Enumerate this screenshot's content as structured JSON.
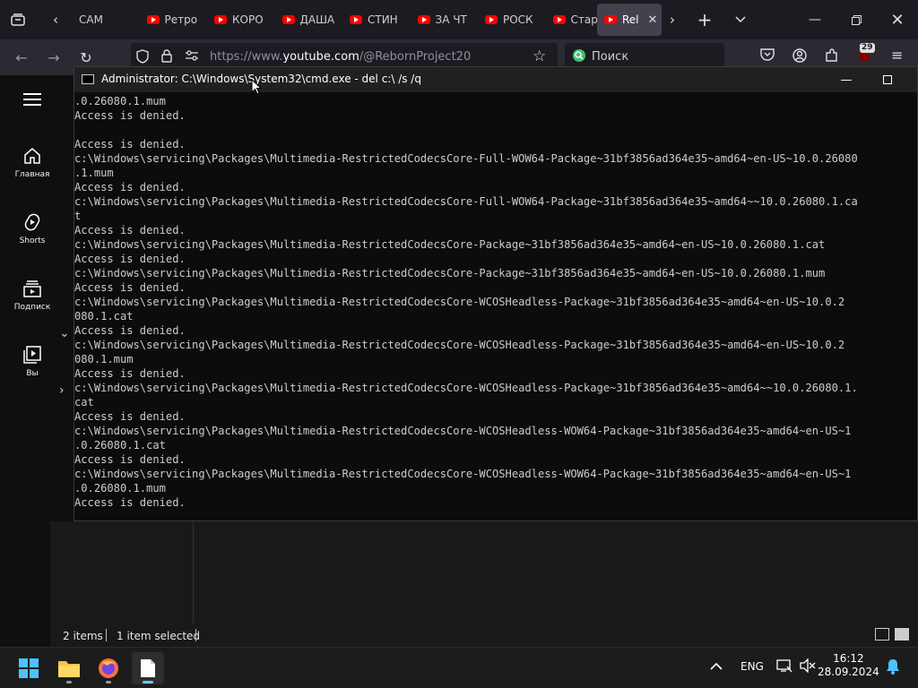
{
  "browser": {
    "tabs": [
      {
        "title": "САМ"
      },
      {
        "title": "Ретро"
      },
      {
        "title": "КОРО"
      },
      {
        "title": "ДАША"
      },
      {
        "title": "СТИН"
      },
      {
        "title": "ЗА ЧТ"
      },
      {
        "title": "РОСК"
      },
      {
        "title": "Старт"
      },
      {
        "title": "Rel",
        "active": true
      }
    ],
    "url_prefix": "https://www.",
    "url_host": "youtube.com",
    "url_path": "/@RebornProject20",
    "search_placeholder": "Поиск",
    "extension_badge": "29",
    "accent_color": "#ff0000"
  },
  "youtube": {
    "sidebar": [
      {
        "label": "Главная",
        "icon": "home-icon"
      },
      {
        "label": "Shorts",
        "icon": "shorts-icon"
      },
      {
        "label": "Подписк",
        "icon": "subscriptions-icon"
      },
      {
        "label": "Вы",
        "icon": "you-icon"
      }
    ]
  },
  "cmd": {
    "title": "Administrator: C:\\Windows\\System32\\cmd.exe - del  c:\\ /s /q",
    "lines": [
      ".0.26080.1.mum",
      "Access is denied.",
      "",
      "Access is denied.",
      "c:\\Windows\\servicing\\Packages\\Multimedia-RestrictedCodecsCore-Full-WOW64-Package~31bf3856ad364e35~amd64~en-US~10.0.26080",
      ".1.mum",
      "Access is denied.",
      "c:\\Windows\\servicing\\Packages\\Multimedia-RestrictedCodecsCore-Full-WOW64-Package~31bf3856ad364e35~amd64~~10.0.26080.1.ca",
      "t",
      "Access is denied.",
      "c:\\Windows\\servicing\\Packages\\Multimedia-RestrictedCodecsCore-Package~31bf3856ad364e35~amd64~en-US~10.0.26080.1.cat",
      "Access is denied.",
      "c:\\Windows\\servicing\\Packages\\Multimedia-RestrictedCodecsCore-Package~31bf3856ad364e35~amd64~en-US~10.0.26080.1.mum",
      "Access is denied.",
      "c:\\Windows\\servicing\\Packages\\Multimedia-RestrictedCodecsCore-WCOSHeadless-Package~31bf3856ad364e35~amd64~en-US~10.0.2",
      "080.1.cat",
      "Access is denied.",
      "c:\\Windows\\servicing\\Packages\\Multimedia-RestrictedCodecsCore-WCOSHeadless-Package~31bf3856ad364e35~amd64~en-US~10.0.2",
      "080.1.mum",
      "Access is denied.",
      "c:\\Windows\\servicing\\Packages\\Multimedia-RestrictedCodecsCore-WCOSHeadless-Package~31bf3856ad364e35~amd64~~10.0.26080.1.",
      "cat",
      "Access is denied.",
      "c:\\Windows\\servicing\\Packages\\Multimedia-RestrictedCodecsCore-WCOSHeadless-WOW64-Package~31bf3856ad364e35~amd64~en-US~1",
      ".0.26080.1.cat",
      "Access is denied.",
      "c:\\Windows\\servicing\\Packages\\Multimedia-RestrictedCodecsCore-WCOSHeadless-WOW64-Package~31bf3856ad364e35~amd64~en-US~1",
      ".0.26080.1.mum",
      "Access is denied."
    ]
  },
  "explorer": {
    "status_items": "2 items",
    "status_selected": "1 item selected"
  },
  "taskbar": {
    "language": "ENG",
    "time": "16:12",
    "date": "28.09.2024"
  }
}
